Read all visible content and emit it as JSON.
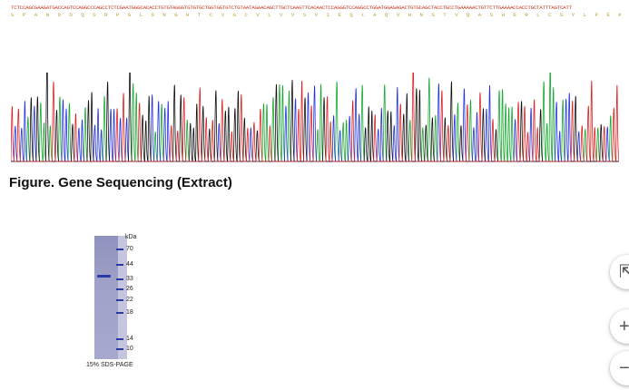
{
  "sequence": {
    "dna": "TCTCCAGCGAAGATGACCAGTCCAGGCCCAGCCTCTCGAATGGGCACACCTGTGTAGGGTGTGTGCTGGTGGTGTCTGTAATAGAACAGCTTGCTCAAGTTCACAACTCCAGGGTCCAGGCCTGGATGGAGAGACTGTGCAGCTACCTGCCTGAAAAACTGTTCTTGAAAACCACCTGCTATTTAGTCATT",
    "protein": "S P A N D D Q S R P G L S N G H T C V G C V L V V S V I E Q L A Q V H N S T V Q A S H E R L C S Y L P E K L F L K T T C Y L V I"
  },
  "figure": {
    "caption": "Figure. Gene Sequencing (Extract)"
  },
  "gel": {
    "unit_label": "kDa",
    "caption": "15% SDS-PAGE",
    "markers": [
      "70",
      "44",
      "33",
      "26",
      "22",
      "18",
      "14",
      "10"
    ]
  },
  "controls": {
    "top": "⇱",
    "zoom_in": "+",
    "zoom_out": "−"
  },
  "colors": {
    "trace_a": "#16a82e",
    "trace_c": "#2233dd",
    "trace_g": "#111111",
    "trace_t": "#dd2222",
    "band": "#2a3aa8"
  }
}
